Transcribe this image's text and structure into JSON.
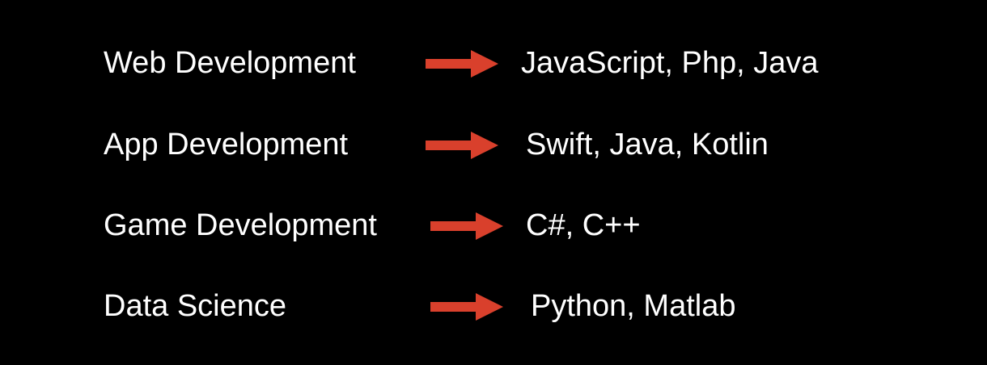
{
  "colors": {
    "background": "#000000",
    "text": "#ffffff",
    "arrow": "#d9402c"
  },
  "rows": [
    {
      "field": "Web Development",
      "languages": "JavaScript, Php, Java",
      "icon": "right-arrow-icon"
    },
    {
      "field": "App Development",
      "languages": "Swift, Java, Kotlin",
      "icon": "right-arrow-icon"
    },
    {
      "field": "Game Development",
      "languages": "C#, C++",
      "icon": "right-arrow-icon"
    },
    {
      "field": "Data Science",
      "languages": "Python, Matlab",
      "icon": "right-arrow-icon"
    }
  ]
}
